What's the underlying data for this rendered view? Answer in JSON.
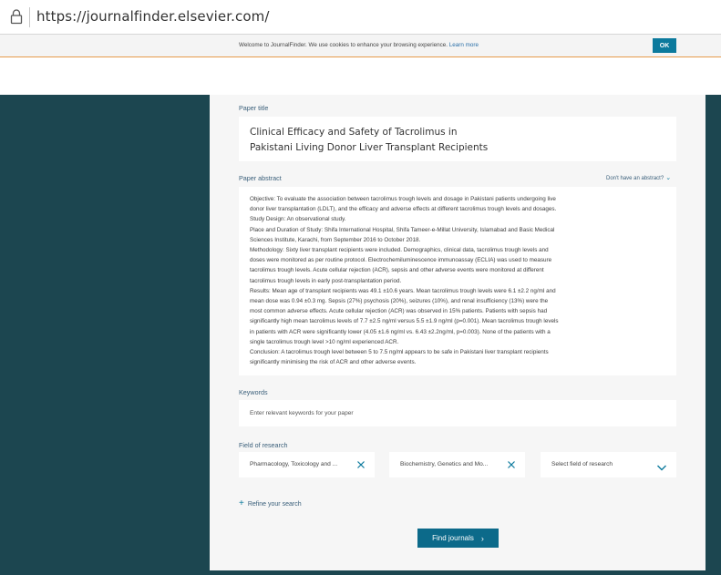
{
  "browser": {
    "url": "https://journalfinder.elsevier.com/"
  },
  "cookie_banner": {
    "text": "Welcome to JournalFinder. We use cookies to enhance your browsing experience.",
    "link": "Learn more",
    "ok_label": "OK"
  },
  "form": {
    "title_label": "Paper title",
    "title_lines": [
      "Clinical Efficacy and Safety of Tacrolimus in",
      "Pakistani Living Donor Liver Transplant Recipients"
    ],
    "abstract_label": "Paper abstract",
    "no_abstract_link": "Don't have an abstract?",
    "abstract_lines": [
      "Objective: To evaluate the association between tacrolimus trough levels and dosage in Pakistani patients undergoing live",
      "donor liver transplantation (LDLT), and the efficacy and adverse effects at different tacrolimus trough levels and dosages.",
      "Study Design: An observational study.",
      "Place and Duration of Study: Shifa International Hospital, Shifa Tameer-e-Millat University, Islamabad and Basic Medical",
      "Sciences Institute, Karachi, from September 2016 to October 2018.",
      "Methodology: Sixty liver transplant recipients were included. Demographics, clinical data, tacrolimus trough levels and",
      "doses were monitored as per routine protocol. Electrochemiluminescence immunoassay (ECLIA) was used to measure",
      "tacrolimus trough levels. Acute cellular rejection (ACR), sepsis and other adverse events were monitored at different",
      "tacrolimus trough levels in early post-transplantation period.",
      "Results: Mean age of transplant recipients was 49.1 ±10.6 years. Mean tacrolimus trough levels were 6.1 ±2.2 ng/ml and",
      "mean dose was 0.94 ±0.3 mg. Sepsis (27%) psychosis (20%), seizures (10%), and renal insufficiency (13%) were the",
      "most common adverse effects. Acute cellular rejection (ACR) was observed in 15% patients. Patients with sepsis had",
      "significantly high mean tacrolimus levels of 7.7 ±2.5 ng/ml versus 5.5 ±1.9 ng/ml (p=0.001). Mean tacrolimus trough levels",
      "in patients with ACR were significantly lower (4.05 ±1.6 ng/ml vs. 6.43 ±2.2ng/ml, p=0.003). None of the patients with a",
      "single tacrolimus trough level >10 ng/ml experienced ACR.",
      "Conclusion: A tacrolimus trough level between 5 to 7.5 ng/ml appears to be safe in Pakistani liver transplant recipients",
      "significantly minimising the risk of ACR and other adverse events."
    ],
    "keywords_label": "Keywords",
    "keywords_placeholder": "Enter relevant keywords for your paper",
    "field_label": "Field of research",
    "fields": [
      "Pharmacology, Toxicology and ...",
      "Biochemistry, Genetics and Mo..."
    ],
    "field_select_placeholder": "Select field of research",
    "refine_label": "Refine your search",
    "find_button": "Find journals"
  }
}
